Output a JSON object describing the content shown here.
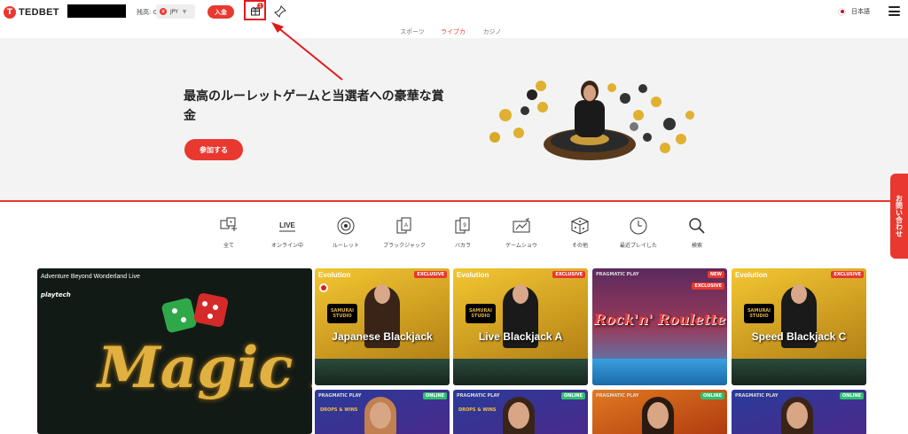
{
  "header": {
    "logo_text": "TEDBET",
    "logo_letter": "T",
    "balance_label": "残高: 0",
    "currency": "JPY",
    "deposit_label": "入金",
    "gift_badge_count": "1",
    "language": "日本語"
  },
  "tabs": [
    {
      "label": "スポーツ"
    },
    {
      "label": "ライブカジノ"
    },
    {
      "label": "カジノ"
    }
  ],
  "banner": {
    "headline": "最高のルーレットゲームと当選者への豪華な賞金",
    "join_label": "参加する"
  },
  "contact_label": "お問い合わせ",
  "categories": [
    {
      "label": "全て",
      "icon": "all-games-icon"
    },
    {
      "label": "オンライン中",
      "icon": "live-icon",
      "icon_text": "LIVE"
    },
    {
      "label": "ルーレット",
      "icon": "roulette-icon"
    },
    {
      "label": "ブラックジャック",
      "icon": "blackjack-icon",
      "icon_text": "A"
    },
    {
      "label": "バカラ",
      "icon": "baccarat-icon",
      "icon_text": "9"
    },
    {
      "label": "ゲームショウ",
      "icon": "game-show-icon"
    },
    {
      "label": "その他",
      "icon": "dice-icon"
    },
    {
      "label": "最近プレイした",
      "icon": "clock-icon"
    },
    {
      "label": "検索",
      "icon": "search-icon"
    }
  ],
  "featured": {
    "title": "Adventure Beyond Wonderland Live",
    "provider": "playtech",
    "art_text": "Magic Di"
  },
  "games": [
    {
      "provider": "Evolution",
      "badge": "EXCLUSIVE",
      "studio": "SAMURAI STUDIO",
      "name": "Japanese Blackjack"
    },
    {
      "provider": "Evolution",
      "badge": "EXCLUSIVE",
      "studio": "SAMURAI STUDIO",
      "name": "Live Blackjack A"
    },
    {
      "provider": "PRAGMATIC PLAY",
      "badge": "NEW",
      "badge2": "EXCLUSIVE",
      "name": "Rock'n' Roulette"
    },
    {
      "provider": "Evolution",
      "badge": "EXCLUSIVE",
      "studio": "SAMURAI STUDIO",
      "name": "Speed Blackjack C"
    }
  ],
  "games_row2": [
    {
      "provider": "PRAGMATIC PLAY",
      "status": "ONLINE",
      "promo": "DROPS & WINS"
    },
    {
      "provider": "PRAGMATIC PLAY",
      "status": "ONLINE",
      "promo": "DROPS & WINS"
    },
    {
      "provider": "PRAGMATIC PLAY",
      "status": "ONLINE",
      "promo": ""
    },
    {
      "provider": "PRAGMATIC PLAY",
      "status": "ONLINE",
      "promo": ""
    }
  ],
  "colors": {
    "brand_red": "#e8382f",
    "highlight_red": "#e21a1a",
    "online_green": "#2fbf71"
  }
}
